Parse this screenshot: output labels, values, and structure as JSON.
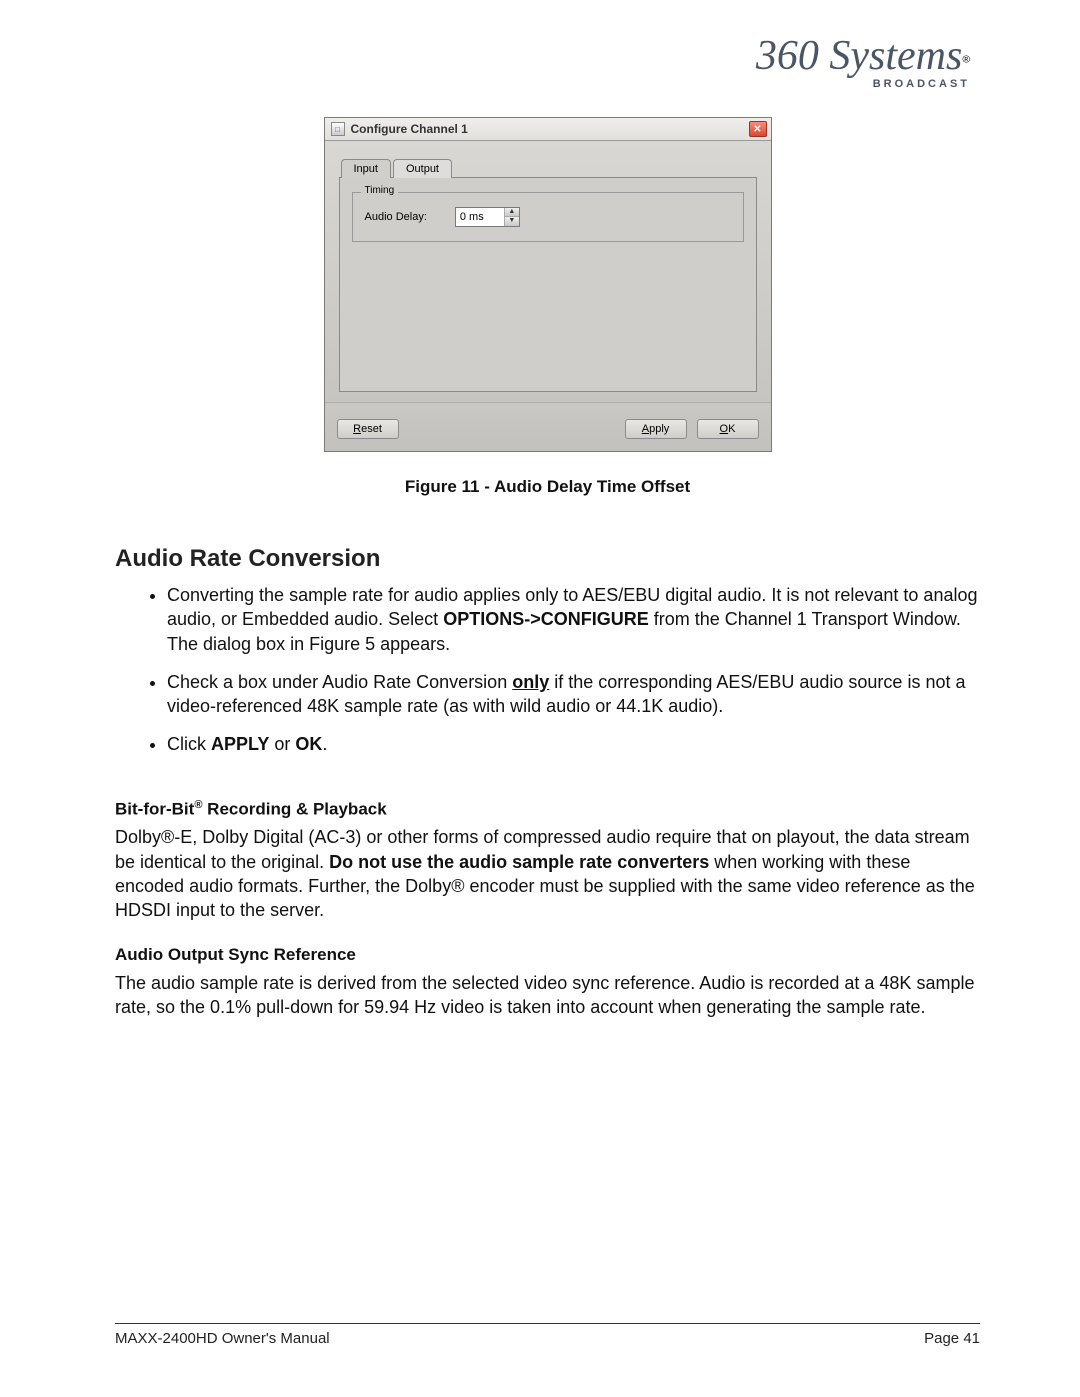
{
  "logo": {
    "script": "360 Systems",
    "sub": "BROADCAST",
    "reg": "®"
  },
  "dialog": {
    "title": "Configure Channel 1",
    "close_glyph": "✕",
    "tabs": {
      "input": "Input",
      "output": "Output"
    },
    "timing_legend": "Timing",
    "audio_delay_label": "Audio Delay:",
    "audio_delay_value": "0 ms",
    "reset": "Reset",
    "apply": "Apply",
    "ok": "OK",
    "reset_ul": "R",
    "apply_ul": "A",
    "ok_ul": "O"
  },
  "figure_caption": "Figure 11 - Audio Delay Time Offset",
  "section_title": "Audio Rate Conversion",
  "bullets": {
    "b1_pre": "Converting the sample rate for audio applies only to AES/EBU digital audio. It is not relevant to analog audio, or Embedded audio. Select ",
    "b1_bold": "OPTIONS->CONFIGURE",
    "b1_post": " from the Channel 1 Transport Window. The dialog box in Figure 5 appears.",
    "b2_pre": "Check a box under Audio Rate Conversion ",
    "b2_ul": "only",
    "b2_post": " if the corresponding AES/EBU audio source is not a video-referenced 48K sample rate (as with wild audio or 44.1K audio).",
    "b3_pre": "Click ",
    "b3_bold1": "APPLY",
    "b3_mid": " or ",
    "b3_bold2": "OK",
    "b3_post": "."
  },
  "sub1": {
    "heading_pre": "Bit-for-Bit",
    "heading_sup": "®",
    "heading_post": " Recording & Playback",
    "para_pre": "Dolby®-E, Dolby Digital (AC-3) or other forms of compressed audio require that on playout, the data stream be identical to the original.  ",
    "para_bold": "Do not use the audio sample rate converters",
    "para_post": " when working with these encoded audio formats. Further, the Dolby® encoder must be supplied with the same video reference as the HDSDI input to the server."
  },
  "sub2": {
    "heading": "Audio Output Sync Reference",
    "para": "The audio sample rate is derived from the selected video sync reference.  Audio is recorded at a 48K sample rate, so the 0.1% pull-down for 59.94 Hz video is taken into account when generating the sample rate."
  },
  "footer": {
    "left": "MAXX-2400HD Owner's Manual",
    "right_label": "Page",
    "right_num": "41"
  }
}
